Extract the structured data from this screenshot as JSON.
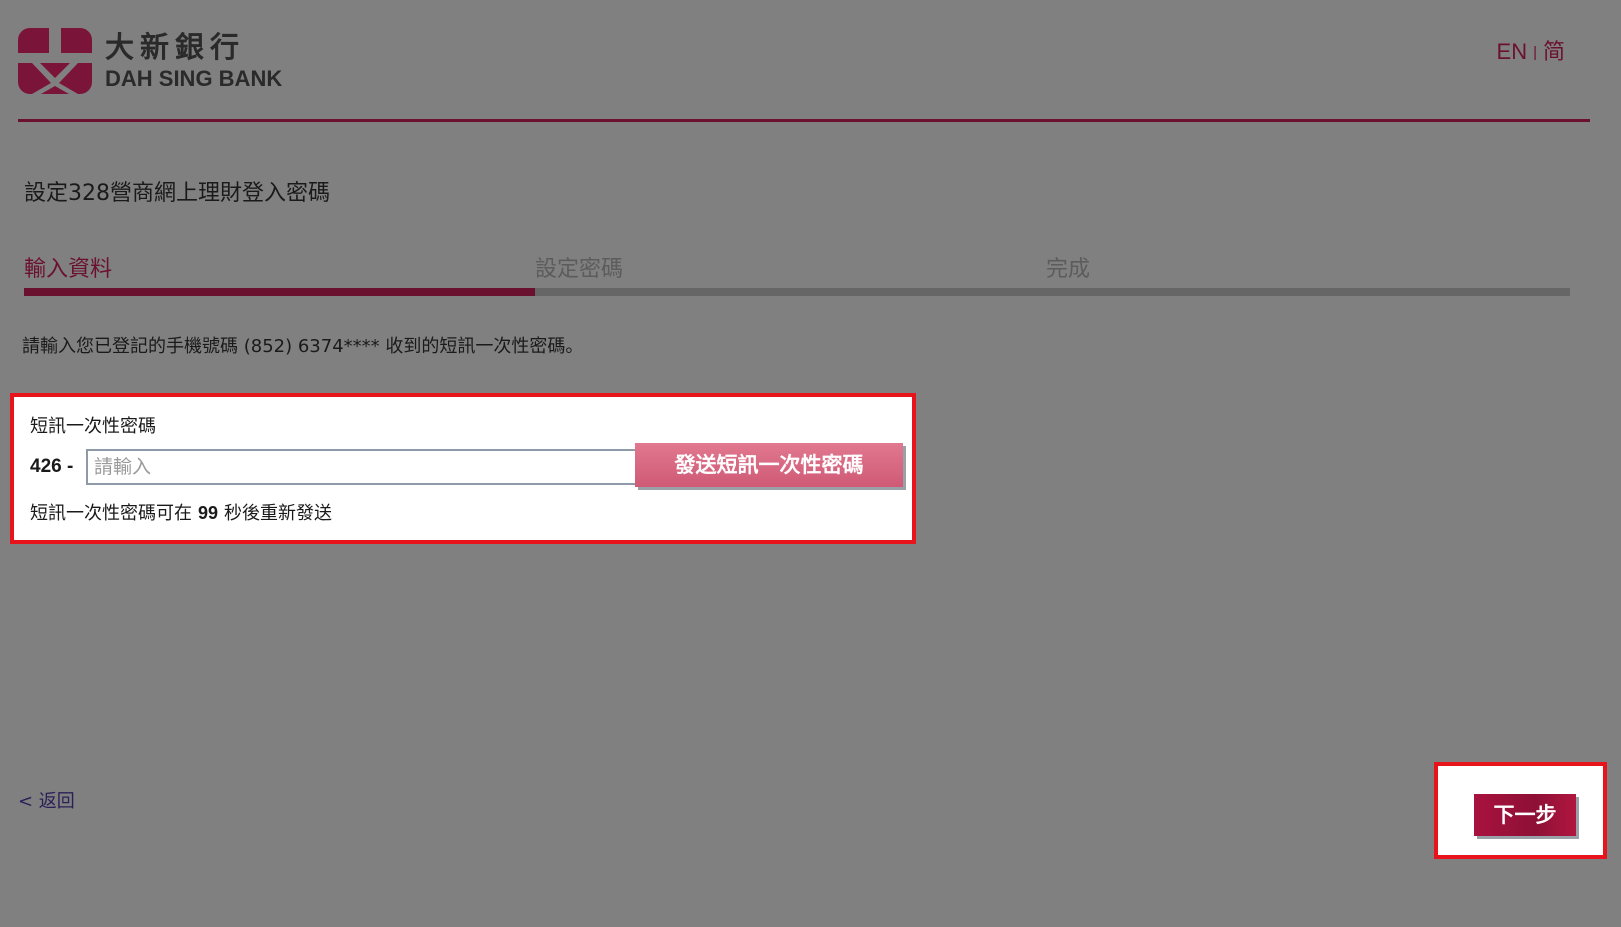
{
  "header": {
    "brand_name_zh": "大新銀行",
    "brand_name_en": "DAH SING BANK",
    "lang_en": "EN",
    "lang_separator": "|",
    "lang_sc": "简"
  },
  "page": {
    "title": "設定328營商網上理財登入密碼"
  },
  "steps": [
    {
      "label": "輸入資料",
      "state": "active"
    },
    {
      "label": "設定密碼",
      "state": "inactive"
    },
    {
      "label": "完成",
      "state": "inactive"
    }
  ],
  "instruction": "請輸入您已登記的手機號碼 (852) 6374**** 收到的短訊一次性密碼。",
  "otp": {
    "label": "短訊一次性密碼",
    "prefix": "426 -",
    "placeholder": "請輸入",
    "value": "",
    "send_button": "發送短訊一次性密碼",
    "resend_before": "短訊一次性密碼可在",
    "resend_seconds": "99",
    "resend_after": "秒後重新發送"
  },
  "footer": {
    "back_label": "< 返回",
    "next_label": "下一步"
  },
  "colors": {
    "background": "#808080",
    "brand": "#6b1130",
    "highlight_frame": "#e8141c",
    "send_button": "#d96480",
    "next_button": "#a8123e"
  },
  "icons": {
    "logo": "dah-sing-logo-icon"
  }
}
